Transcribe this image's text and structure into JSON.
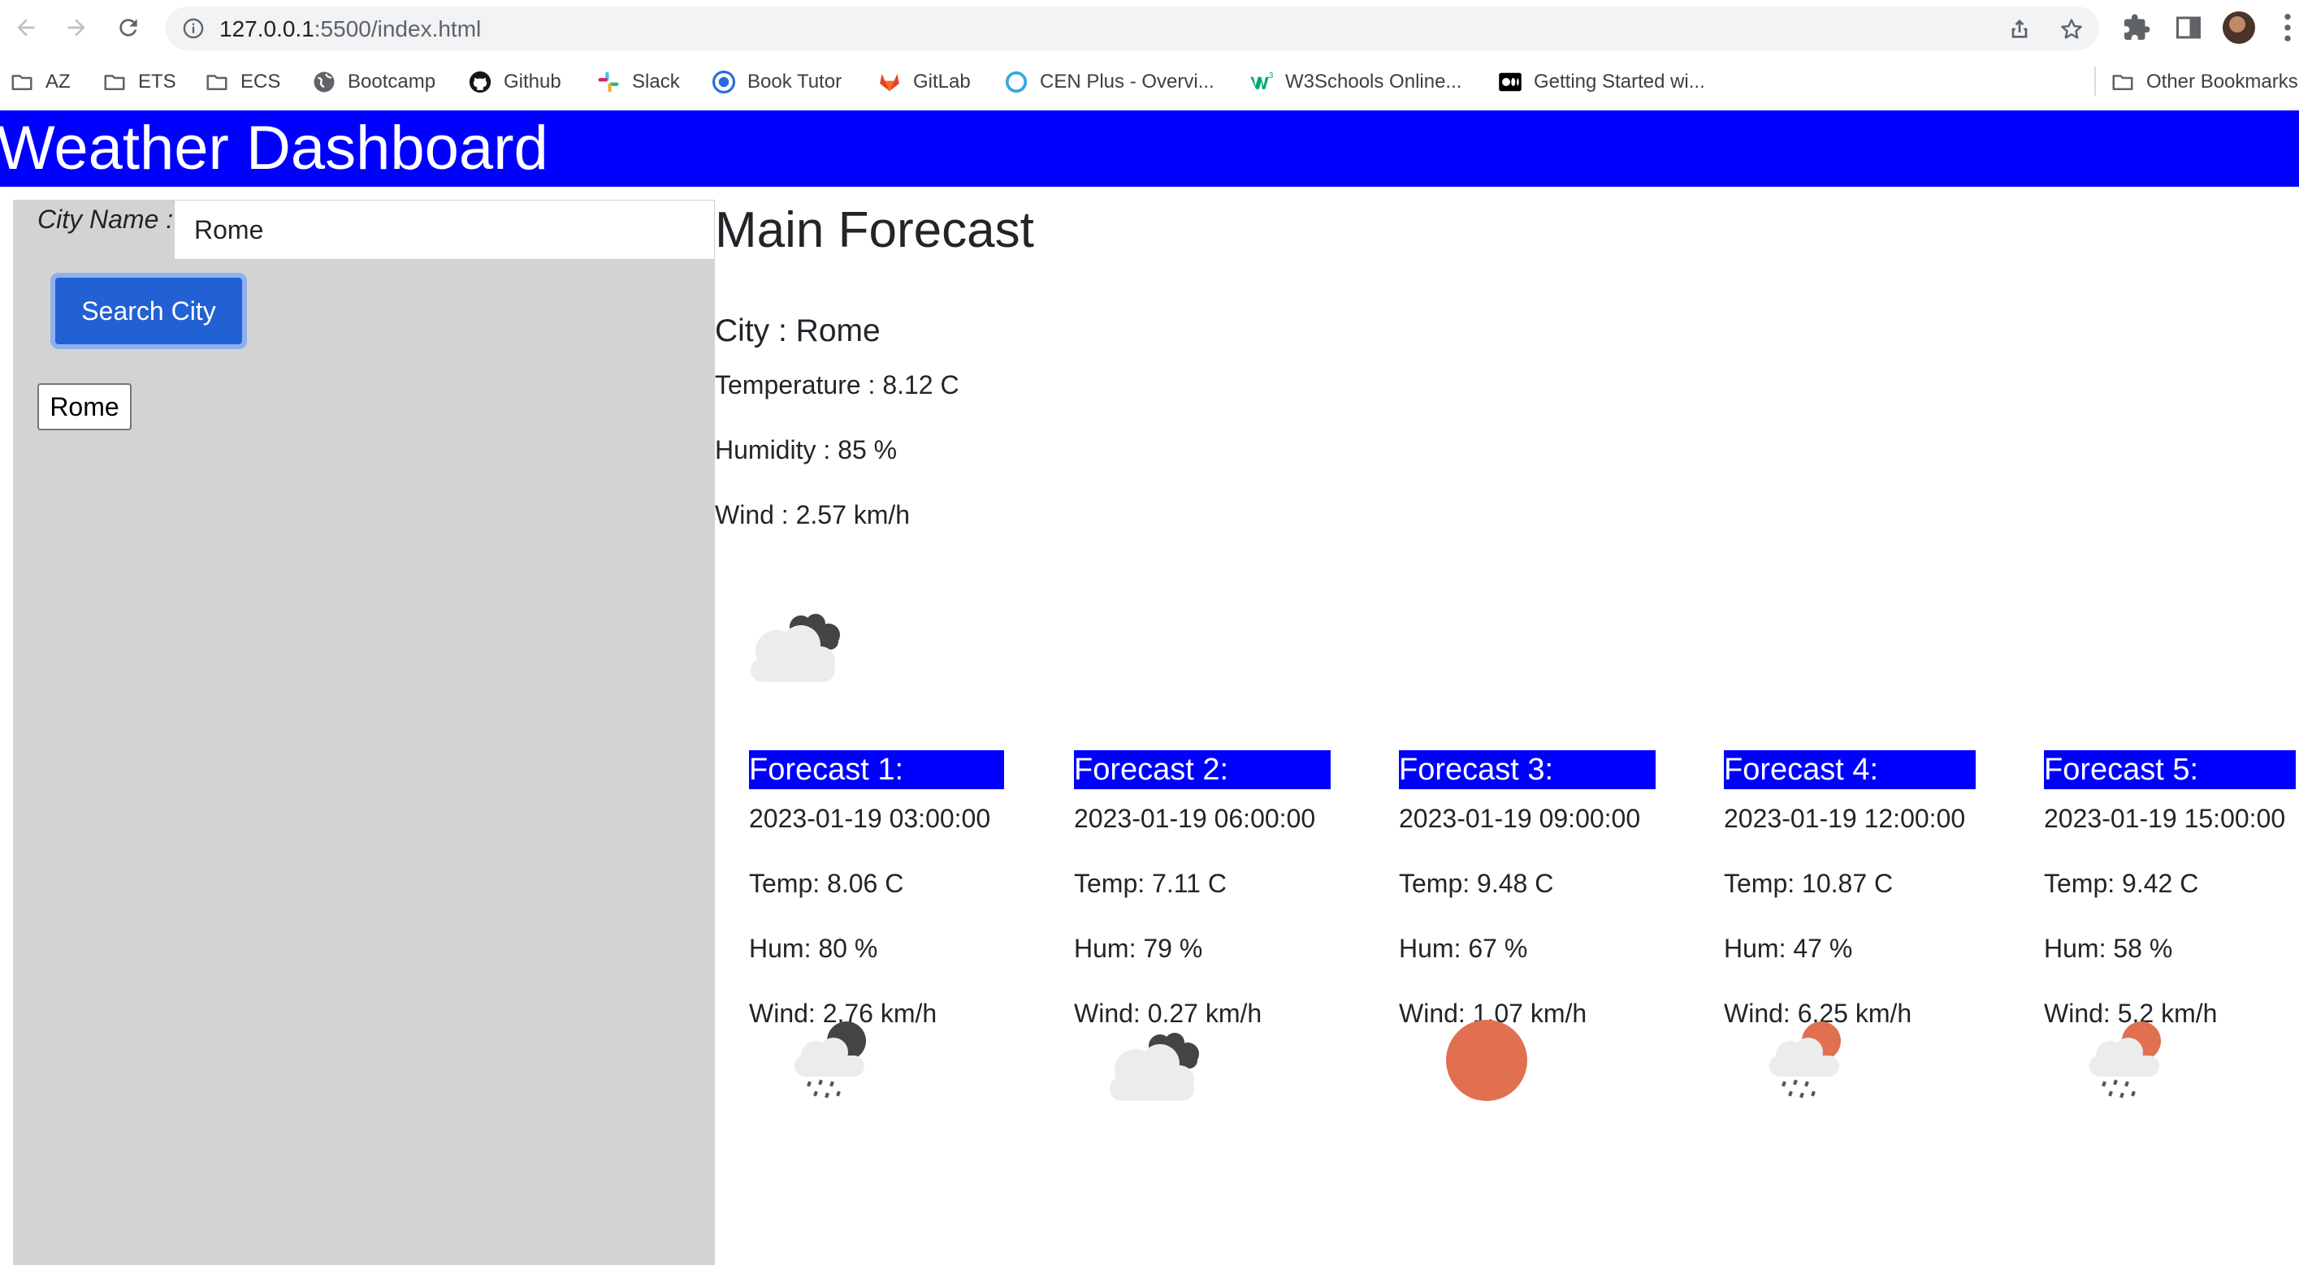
{
  "browser": {
    "url_host": "127.0.0.1",
    "url_path": ":5500/index.html",
    "bookmarks": [
      {
        "label": "AZ",
        "icon": "folder-icon"
      },
      {
        "label": "ETS",
        "icon": "folder-icon"
      },
      {
        "label": "ECS",
        "icon": "folder-icon"
      },
      {
        "label": "Bootcamp",
        "icon": "globe-icon"
      },
      {
        "label": "Github",
        "icon": "github-icon"
      },
      {
        "label": "Slack",
        "icon": "slack-icon"
      },
      {
        "label": "Book Tutor",
        "icon": "book-tutor-icon"
      },
      {
        "label": "GitLab",
        "icon": "gitlab-icon"
      },
      {
        "label": "CEN Plus - Overvi...",
        "icon": "cen-plus-icon"
      },
      {
        "label": "W3Schools Online...",
        "icon": "w3schools-icon"
      },
      {
        "label": "Getting Started wi...",
        "icon": "medium-icon"
      }
    ],
    "other_bookmarks": "Other Bookmarks"
  },
  "header": {
    "title": "Weather Dashboard"
  },
  "sidebar": {
    "city_label": "City Name :",
    "city_value": "Rome",
    "search_button": "Search City",
    "history": [
      "Rome"
    ]
  },
  "main": {
    "title": "Main Forecast",
    "city": "City : Rome",
    "temperature": "Temperature : 8.12 C",
    "humidity": "Humidity : 85 %",
    "wind": "Wind : 2.57 km/h",
    "icon": "cloudy-dark-icon"
  },
  "forecast": [
    {
      "title": "Forecast 1:",
      "date": "2023-01-19 03:00:00",
      "temp": "Temp: 8.06 C",
      "hum": "Hum: 80 %",
      "wind": "Wind: 2.76 km/h",
      "icon": "rain-night-icon"
    },
    {
      "title": "Forecast 2:",
      "date": "2023-01-19 06:00:00",
      "temp": "Temp: 7.11 C",
      "hum": "Hum: 79 %",
      "wind": "Wind: 0.27 km/h",
      "icon": "cloudy-dark-icon"
    },
    {
      "title": "Forecast 3:",
      "date": "2023-01-19 09:00:00",
      "temp": "Temp: 9.48 C",
      "hum": "Hum: 67 %",
      "wind": "Wind: 1.07 km/h",
      "icon": "sun-icon"
    },
    {
      "title": "Forecast 4:",
      "date": "2023-01-19 12:00:00",
      "temp": "Temp: 10.87 C",
      "hum": "Hum: 47 %",
      "wind": "Wind: 6.25 km/h",
      "icon": "rain-sun-icon"
    },
    {
      "title": "Forecast 5:",
      "date": "2023-01-19 15:00:00",
      "temp": "Temp: 9.42 C",
      "hum": "Hum: 58 %",
      "wind": "Wind: 5.2 km/h",
      "icon": "rain-sun-icon"
    }
  ],
  "colors": {
    "header": "#0000ff",
    "sidebar": "#d3d3d3",
    "button": "#2261d4",
    "sun": "#e07050"
  }
}
